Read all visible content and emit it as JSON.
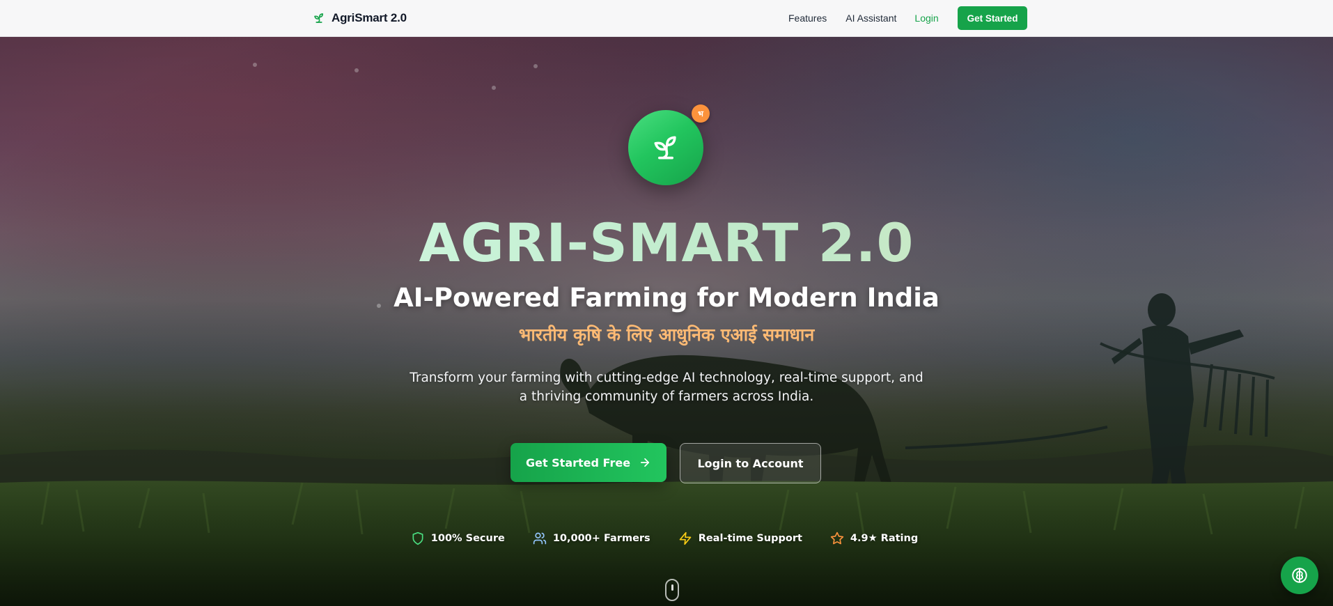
{
  "navbar": {
    "brand": {
      "icon": "sprout-icon",
      "name": "AgriSmart 2.0"
    },
    "links": {
      "features": "Features",
      "assistant": "AI Assistant",
      "login": "Login"
    },
    "cta_label": "Get Started"
  },
  "hero": {
    "logo_icon": "sprout-icon",
    "logo_badge": "भ",
    "title": "AGRI-SMART 2.0",
    "subtitle": "AI-Powered Farming for Modern India",
    "hindi_subtitle": "भारतीय कृषि के लिए आधुनिक एआई समाधान",
    "description": "Transform your farming with cutting-edge AI technology, real-time support, and a thriving community of farmers across India.",
    "primary_button": {
      "label": "Get Started Free",
      "icon": "arrow-right-icon"
    },
    "secondary_button": {
      "label": "Login to Account"
    },
    "features": [
      {
        "label": "100% Secure",
        "icon": "shield-icon",
        "color": "#4ade80"
      },
      {
        "label": "10,000+ Farmers",
        "icon": "users-icon",
        "color": "#93c5fd"
      },
      {
        "label": "Real-time Support",
        "icon": "lightning-icon",
        "color": "#facc15"
      },
      {
        "label": "4.9★ Rating",
        "icon": "star-icon",
        "color": "#fb923c"
      }
    ]
  },
  "floating_button": {
    "icon": "brain-icon"
  },
  "colors": {
    "brand_green": "#16a34a",
    "brand_green_light": "#22c55e",
    "accent_orange": "#fb923c",
    "hindi_text": "#fdba74"
  }
}
